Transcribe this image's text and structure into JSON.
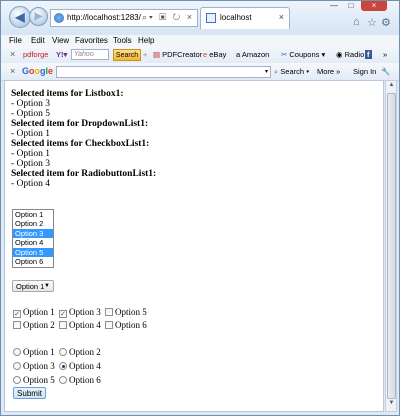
{
  "browser": {
    "url": "http://localhost:1283/ListBo",
    "tab_title": "localhost",
    "menu": [
      "File",
      "Edit",
      "View",
      "Favorites",
      "Tools",
      "Help"
    ],
    "toolbar1": {
      "pdforge": "pdforge",
      "yahoo_placeholder": "Yahoo",
      "search": "Search",
      "items": [
        "PDFCreator",
        "eBay",
        "Amazon",
        "Coupons",
        "Radio"
      ]
    },
    "toolbar2": {
      "google": [
        "G",
        "o",
        "o",
        "g",
        "l",
        "e"
      ],
      "search": "Search",
      "more": "More »",
      "signin": "Sign In"
    }
  },
  "page": {
    "results": [
      {
        "heading": "Selected items for Listbox1:",
        "lines": [
          "- Option 3",
          "- Option 5"
        ]
      },
      {
        "heading": "Selected item for DropdownList1:",
        "lines": [
          "- Option 1"
        ]
      },
      {
        "heading": "Selected items for CheckboxList1:",
        "lines": [
          "- Option 1",
          "- Option 3"
        ]
      },
      {
        "heading": "Selected item for RadiobuttonList1:",
        "lines": [
          "- Option 4"
        ]
      }
    ],
    "listbox": [
      "Option 1",
      "Option 2",
      "Option 3",
      "Option 4",
      "Option 5",
      "Option 6"
    ],
    "dropdown_value": "Option 1",
    "checkboxes": [
      {
        "label": "Option 1",
        "checked": true
      },
      {
        "label": "Option 3",
        "checked": true
      },
      {
        "label": "Option 5",
        "checked": false
      },
      {
        "label": "Option 2",
        "checked": false
      },
      {
        "label": "Option 4",
        "checked": false
      },
      {
        "label": "Option 6",
        "checked": false
      }
    ],
    "radios": [
      {
        "label": "Option 1",
        "checked": false
      },
      {
        "label": "Option 2",
        "checked": false
      },
      {
        "label": "Option 3",
        "checked": false
      },
      {
        "label": "Option 4",
        "checked": true
      },
      {
        "label": "Option 5",
        "checked": false
      },
      {
        "label": "Option 6",
        "checked": false
      }
    ],
    "submit": "Submit"
  },
  "colors": {
    "selection": "#3399ff",
    "close_button": "#c9463d"
  }
}
